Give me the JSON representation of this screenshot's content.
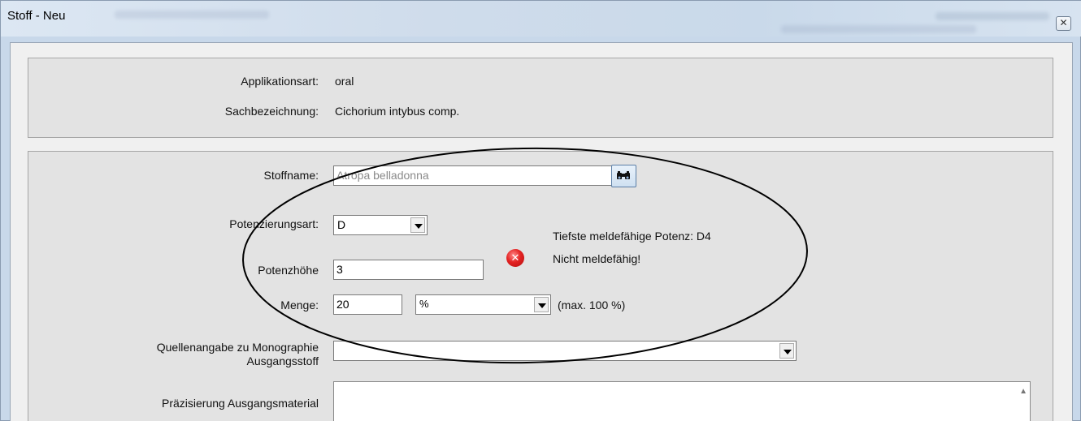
{
  "window": {
    "title": "Stoff - Neu",
    "close_glyph": "✕"
  },
  "info": {
    "applikationsart_label": "Applikationsart:",
    "applikationsart_value": "oral",
    "sachbezeichnung_label": "Sachbezeichnung:",
    "sachbezeichnung_value": "Cichorium intybus comp."
  },
  "form": {
    "stoffname_label": "Stoffname:",
    "stoffname_value": "Atropa belladonna",
    "search_icon": "binoculars-icon",
    "potenzierungsart_label": "Potenzierungsart:",
    "potenzierungsart_value": "D",
    "potenzhoehe_label": "Potenzhöhe",
    "potenzhoehe_value": "3",
    "menge_label": "Menge:",
    "menge_value": "20",
    "menge_unit": "%",
    "menge_hint": "(max. 100 %)",
    "min_potenz_text": "Tiefste meldefähige Potenz: D4",
    "error_text": "Nicht meldefähig!",
    "error_icon": "error-x-icon",
    "quelle_label_line1": "Quellenangabe zu Monographie",
    "quelle_label_line2": "Ausgangsstoff",
    "quelle_value": "",
    "praezisierung_label": "Präzisierung Ausgangsmaterial",
    "praezisierung_value": ""
  },
  "colors": {
    "error_red": "#e32222",
    "annotation_stroke": "#000000"
  }
}
